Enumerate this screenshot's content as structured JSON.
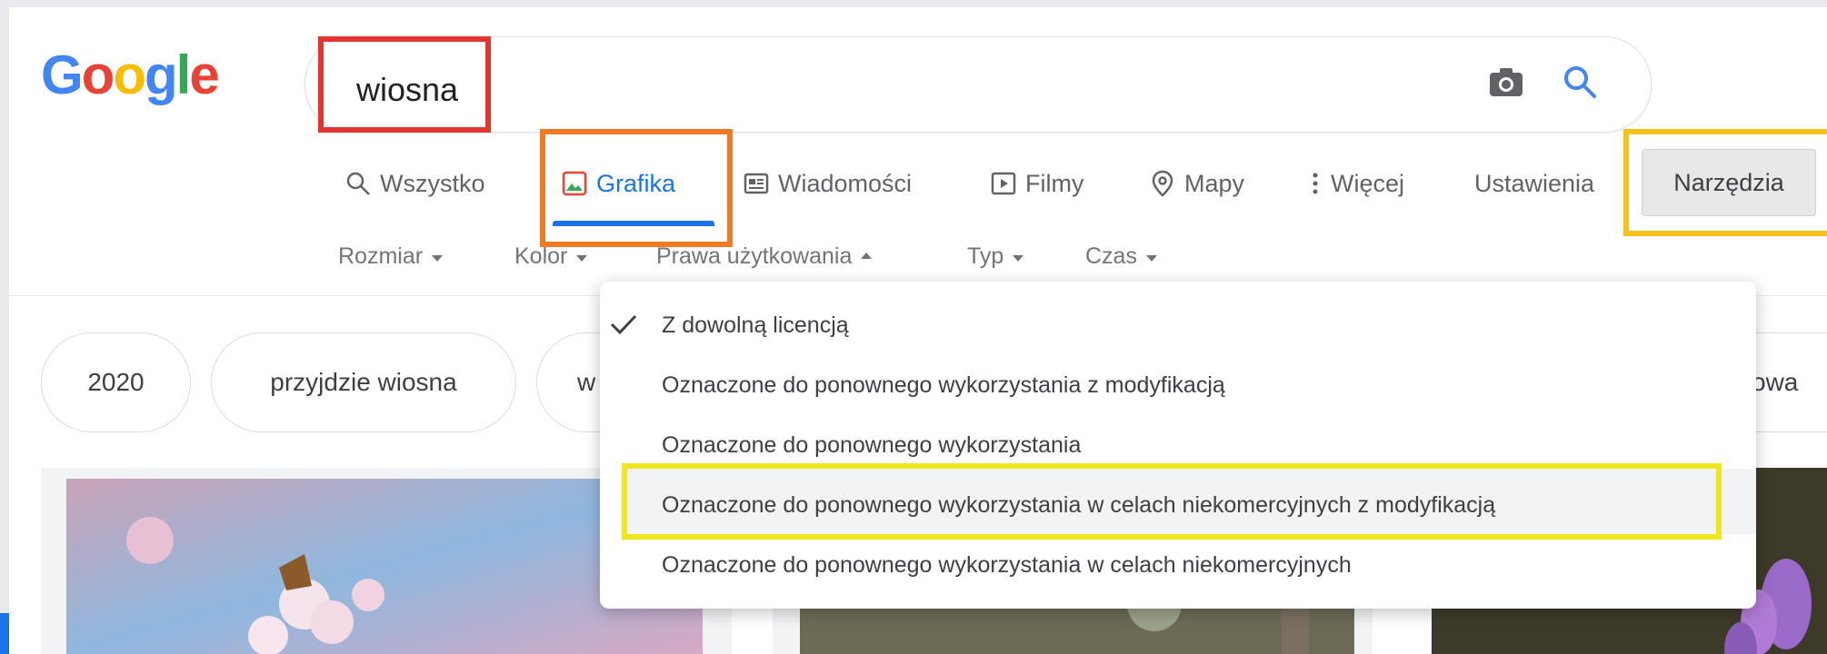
{
  "logo": {
    "text": "Google"
  },
  "search": {
    "query": "wiosna"
  },
  "nav": {
    "tabs": [
      {
        "label": "Wszystko",
        "icon": "search-icon"
      },
      {
        "label": "Grafika",
        "icon": "image-icon",
        "active": true
      },
      {
        "label": "Wiadomości",
        "icon": "news-icon"
      },
      {
        "label": "Filmy",
        "icon": "play-icon"
      },
      {
        "label": "Mapy",
        "icon": "map-pin-icon"
      },
      {
        "label": "Więcej",
        "icon": "more-vert-icon"
      }
    ],
    "settings_label": "Ustawienia",
    "tools_label": "Narzędzia"
  },
  "filters": [
    {
      "label": "Rozmiar",
      "state": "collapsed"
    },
    {
      "label": "Kolor",
      "state": "collapsed"
    },
    {
      "label": "Prawa użytkowania",
      "state": "expanded"
    },
    {
      "label": "Typ",
      "state": "collapsed"
    },
    {
      "label": "Czas",
      "state": "collapsed"
    }
  ],
  "chips": [
    {
      "label": "2020"
    },
    {
      "label": "przyjdzie wiosna"
    },
    {
      "label": "w"
    },
    {
      "label": "zowa"
    }
  ],
  "usage_rights_menu": {
    "items": [
      {
        "label": "Z dowolną licencją",
        "selected": true
      },
      {
        "label": "Oznaczone do ponownego wykorzystania z modyfikacją"
      },
      {
        "label": "Oznaczone do ponownego wykorzystania"
      },
      {
        "label": "Oznaczone do ponownego wykorzystania w celach niekomercyjnych z modyfikacją",
        "highlighted": true
      },
      {
        "label": "Oznaczone do ponownego wykorzystania w celach niekomercyjnych"
      }
    ]
  },
  "colors": {
    "accent": "#1a73e8",
    "highlight_red": "#e3342f",
    "highlight_orange": "#f07a24",
    "highlight_yellow": "#f5c21b"
  }
}
